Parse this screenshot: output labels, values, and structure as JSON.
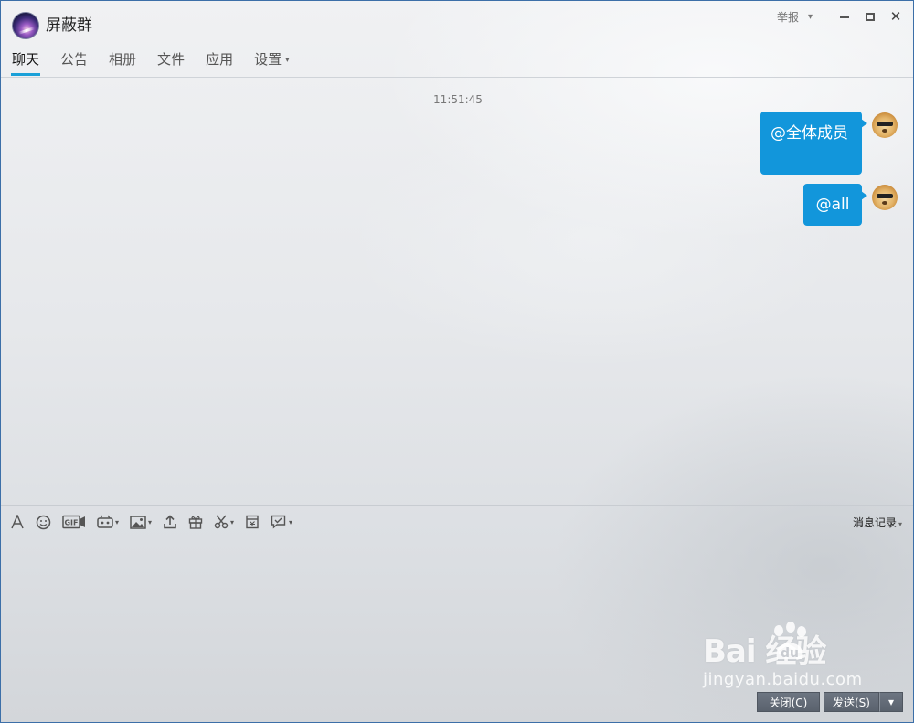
{
  "window": {
    "group_name": "屏蔽群",
    "report_label": "举报",
    "report_arrow": "▾",
    "minimize_glyph": "",
    "close_glyph": "✕"
  },
  "tabs": [
    {
      "label": "聊天",
      "active": true
    },
    {
      "label": "公告"
    },
    {
      "label": "相册"
    },
    {
      "label": "文件"
    },
    {
      "label": "应用"
    },
    {
      "label": "设置",
      "caret": "▾"
    }
  ],
  "chat": {
    "timestamp": "11:51:45",
    "messages": [
      {
        "text": "@全体成员",
        "from": "self"
      },
      {
        "text": "@all",
        "from": "self"
      }
    ]
  },
  "toolbar": {
    "icons": [
      "font-icon",
      "emoji-icon",
      "gif-icon",
      "magic-expression-icon",
      "image-icon",
      "upload-icon",
      "gift-icon",
      "screenshot-icon",
      "red-envelope-icon",
      "reply-check-icon"
    ],
    "history_label": "消息记录",
    "history_caret": "▾",
    "dropdown_caret": "▾"
  },
  "buttons": {
    "close_label": "关闭(C)",
    "send_label": "发送(S)",
    "send_more": "▾"
  },
  "watermark": {
    "logo": "Bai  经验",
    "url": "jingyan.baidu.com"
  },
  "colors": {
    "accent": "#1aa0d8",
    "bubble": "#1296db",
    "button": "#5e6670"
  }
}
